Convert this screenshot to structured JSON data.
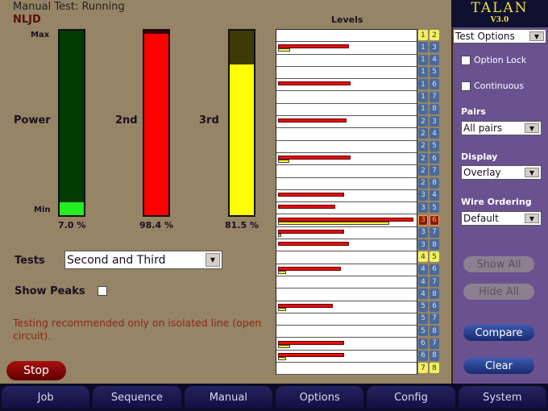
{
  "status": "Manual Test: Running",
  "mode": "NLJD",
  "meters": {
    "max_label": "Max",
    "min_label": "Min",
    "items": [
      {
        "label": "Power",
        "percent": 7.0,
        "text": "7.0 %",
        "fill_color": "#22ee22",
        "bg_color": "#003c00"
      },
      {
        "label": "2nd",
        "percent": 98.4,
        "text": "98.4 %",
        "fill_color": "#ff0000",
        "bg_color": "#400000"
      },
      {
        "label": "3rd",
        "percent": 81.5,
        "text": "81.5 %",
        "fill_color": "#ffff00",
        "bg_color": "#3e3a08"
      }
    ]
  },
  "tests": {
    "label": "Tests",
    "value": "Second and Third"
  },
  "show_peaks": {
    "label": "Show Peaks",
    "checked": false
  },
  "warning": "Testing recommended only on isolated line (open circuit).",
  "stop_label": "Stop",
  "levels": {
    "title": "Levels",
    "pairs": [
      {
        "a": "1",
        "b": "2",
        "state": "selected",
        "second": 0,
        "third": 0
      },
      {
        "a": "1",
        "b": "3",
        "state": "normal",
        "second": 0.52,
        "third": 0.09
      },
      {
        "a": "1",
        "b": "4",
        "state": "normal",
        "second": 0,
        "third": 0
      },
      {
        "a": "1",
        "b": "5",
        "state": "normal",
        "second": 0,
        "third": 0
      },
      {
        "a": "1",
        "b": "6",
        "state": "normal",
        "second": 0.53,
        "third": 0
      },
      {
        "a": "1",
        "b": "7",
        "state": "normal",
        "second": 0,
        "third": 0
      },
      {
        "a": "1",
        "b": "8",
        "state": "normal",
        "second": 0,
        "third": 0
      },
      {
        "a": "2",
        "b": "3",
        "state": "normal",
        "second": 0.5,
        "third": 0
      },
      {
        "a": "2",
        "b": "4",
        "state": "normal",
        "second": 0,
        "third": 0
      },
      {
        "a": "2",
        "b": "5",
        "state": "normal",
        "second": 0,
        "third": 0
      },
      {
        "a": "2",
        "b": "6",
        "state": "normal",
        "second": 0.53,
        "third": 0.08
      },
      {
        "a": "2",
        "b": "7",
        "state": "normal",
        "second": 0,
        "third": 0
      },
      {
        "a": "2",
        "b": "8",
        "state": "normal",
        "second": 0,
        "third": 0
      },
      {
        "a": "3",
        "b": "4",
        "state": "normal",
        "second": 0.48,
        "third": 0
      },
      {
        "a": "3",
        "b": "5",
        "state": "normal",
        "second": 0.42,
        "third": 0
      },
      {
        "a": "3",
        "b": "6",
        "state": "alert",
        "second": 0.99,
        "third": 0.81
      },
      {
        "a": "3",
        "b": "7",
        "state": "normal",
        "second": 0.48,
        "third": 0.02
      },
      {
        "a": "3",
        "b": "8",
        "state": "normal",
        "second": 0.52,
        "third": 0
      },
      {
        "a": "4",
        "b": "5",
        "state": "selected",
        "second": 0,
        "third": 0
      },
      {
        "a": "4",
        "b": "6",
        "state": "normal",
        "second": 0.46,
        "third": 0.06
      },
      {
        "a": "4",
        "b": "7",
        "state": "normal",
        "second": 0,
        "third": 0
      },
      {
        "a": "4",
        "b": "8",
        "state": "normal",
        "second": 0,
        "third": 0
      },
      {
        "a": "5",
        "b": "6",
        "state": "normal",
        "second": 0.4,
        "third": 0.06
      },
      {
        "a": "5",
        "b": "7",
        "state": "normal",
        "second": 0,
        "third": 0
      },
      {
        "a": "5",
        "b": "8",
        "state": "normal",
        "second": 0,
        "third": 0
      },
      {
        "a": "6",
        "b": "7",
        "state": "normal",
        "second": 0.48,
        "third": 0.09
      },
      {
        "a": "6",
        "b": "8",
        "state": "normal",
        "second": 0.48,
        "third": 0.06
      },
      {
        "a": "7",
        "b": "8",
        "state": "selected",
        "second": 0,
        "third": 0
      }
    ]
  },
  "sidebar": {
    "logo": "TALAN",
    "version": "V3.0",
    "options_select": "Test Options",
    "option_lock": "Option Lock",
    "continuous": "Continuous",
    "pairs_label": "Pairs",
    "pairs_value": "All pairs",
    "display_label": "Display",
    "display_value": "Overlay",
    "wire_label": "Wire Ordering",
    "wire_value": "Default",
    "show_all": "Show All",
    "hide_all": "Hide All",
    "compare": "Compare",
    "clear": "Clear"
  },
  "nav": [
    "Job",
    "Sequence",
    "Manual",
    "Options",
    "Config",
    "System"
  ]
}
